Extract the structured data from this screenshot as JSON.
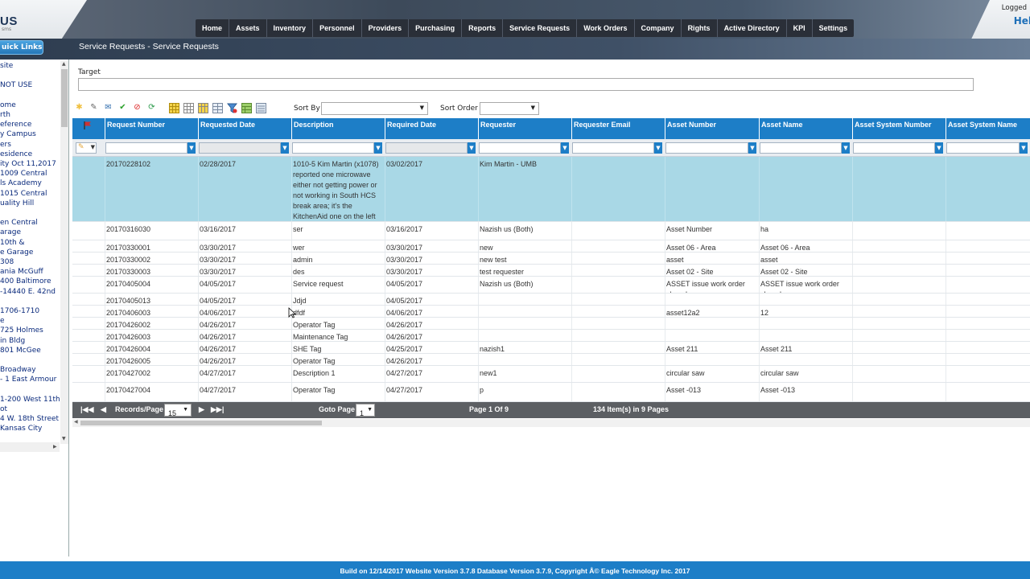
{
  "app": {
    "logo_text": "US",
    "logo_sub": "sms",
    "logged_text": "Logged",
    "help_text": "Hel"
  },
  "nav": [
    "Home",
    "Assets",
    "Inventory",
    "Personnel",
    "Providers",
    "Purchasing",
    "Reports",
    "Service Requests",
    "Work Orders",
    "Company",
    "Rights",
    "Active Directory",
    "KPI",
    "Settings"
  ],
  "quick_links": "uick Links",
  "page_title": "Service Requests - Service Requests",
  "sidebar": {
    "items": [
      "site",
      "",
      "NOT USE",
      "",
      "ome",
      "rth",
      "eference",
      "y Campus",
      "ers",
      "esidence",
      "ity Oct 11,2017",
      "1009 Central",
      "ls Academy",
      "1015 Central",
      "uality Hill",
      "",
      "en Central",
      "arage",
      "10th &",
      "e Garage",
      "308",
      "ania McGuff",
      "400 Baltimore",
      "-14440 E. 42nd",
      "",
      " 1706-1710",
      "e",
      "725 Holmes",
      "in Bldg",
      "801 McGee",
      "",
      " Broadway",
      "- 1 East Armour",
      "",
      "1-200 West 11th",
      "ot",
      "4 W. 18th Street",
      "Kansas City"
    ]
  },
  "target": {
    "label": "Target",
    "value": ""
  },
  "toolbar": {
    "icons": [
      "new-icon",
      "edit-icon",
      "email-icon",
      "approve-icon",
      "cancel-icon",
      "export-icon",
      "grid-icon",
      "grid-view-icon",
      "grid-columns-icon",
      "grid-layout-icon",
      "filter-clear-icon",
      "group-icon",
      "settings-grid-icon"
    ],
    "sort_by_label": "Sort By",
    "sort_by_value": "",
    "sort_order_label": "Sort Order",
    "sort_order_value": ""
  },
  "grid": {
    "columns": [
      "Request Number",
      "Requested Date",
      "Description",
      "Required Date",
      "Requester",
      "Requester Email",
      "Asset Number",
      "Asset Name",
      "Asset System Number",
      "Asset System Name"
    ],
    "rows": [
      [
        "20170228102",
        "02/28/2017",
        "1010-5 Kim Martin (x1078) reported one microwave either not getting power or not working in South HCS break area; it's the KitchenAid one on the left",
        "03/02/2017",
        "Kim Martin - UMB",
        "",
        "",
        "",
        "",
        ""
      ],
      [
        "20170316030",
        "03/16/2017",
        "ser",
        "03/16/2017",
        "Nazish us (Both)",
        "",
        "Asset Number",
        "ha",
        "",
        ""
      ],
      [
        "20170330001",
        "03/30/2017",
        "wer",
        "03/30/2017",
        "new",
        "",
        "Asset 06 - Area",
        "Asset 06 - Area",
        "",
        ""
      ],
      [
        "20170330002",
        "03/30/2017",
        "admin",
        "03/30/2017",
        "new test",
        "",
        "asset",
        "asset",
        "",
        ""
      ],
      [
        "20170330003",
        "03/30/2017",
        "des",
        "03/30/2017",
        "test requester",
        "",
        "Asset 02 - Site",
        "Asset 02 - Site",
        "",
        ""
      ],
      [
        "20170405004",
        "04/05/2017",
        "Service request",
        "04/05/2017",
        "Nazish us (Both)",
        "",
        "ASSET issue work order closed",
        "ASSET issue work order closed",
        "",
        ""
      ],
      [
        "20170405013",
        "04/05/2017",
        "Jdjd",
        "04/05/2017",
        "",
        "",
        "",
        "",
        "",
        ""
      ],
      [
        "20170406003",
        "04/06/2017",
        "dfdf",
        "04/06/2017",
        "",
        "",
        "asset12a2",
        "12",
        "",
        ""
      ],
      [
        "20170426002",
        "04/26/2017",
        "Operator Tag",
        "04/26/2017",
        "",
        "",
        "",
        "",
        "",
        ""
      ],
      [
        "20170426003",
        "04/26/2017",
        "Maintenance Tag",
        "04/26/2017",
        "",
        "",
        "",
        "",
        "",
        ""
      ],
      [
        "20170426004",
        "04/26/2017",
        "SHE Tag",
        "04/25/2017",
        "nazish1",
        "",
        "Asset 211",
        "Asset 211",
        "",
        ""
      ],
      [
        "20170426005",
        "04/26/2017",
        "Operator Tag",
        "04/26/2017",
        "",
        "",
        "",
        "",
        "",
        ""
      ],
      [
        "20170427002",
        "04/27/2017",
        "Description 1",
        "04/27/2017",
        "new1",
        "",
        "circular saw",
        "circular saw",
        "",
        ""
      ],
      [
        "20170427004",
        "04/27/2017",
        "Operator Tag",
        "04/27/2017",
        "p",
        "",
        "Asset -013",
        "Asset -013",
        "",
        ""
      ]
    ]
  },
  "pager": {
    "records_label": "Records/Page",
    "records_value": "15",
    "goto_label": "Goto Page",
    "goto_value": "1",
    "page_info": "Page 1 Of 9",
    "items_info": "134 Item(s) in 9 Pages"
  },
  "footer": "Build on 12/14/2017 Website Version 3.7.8 Database Version 3.7.9, Copyright Â© Eagle Technology Inc. 2017",
  "colors": {
    "accent": "#1d7ec7",
    "selected_row": "#a9d8e6",
    "nav_bg": "#2a2f38"
  }
}
